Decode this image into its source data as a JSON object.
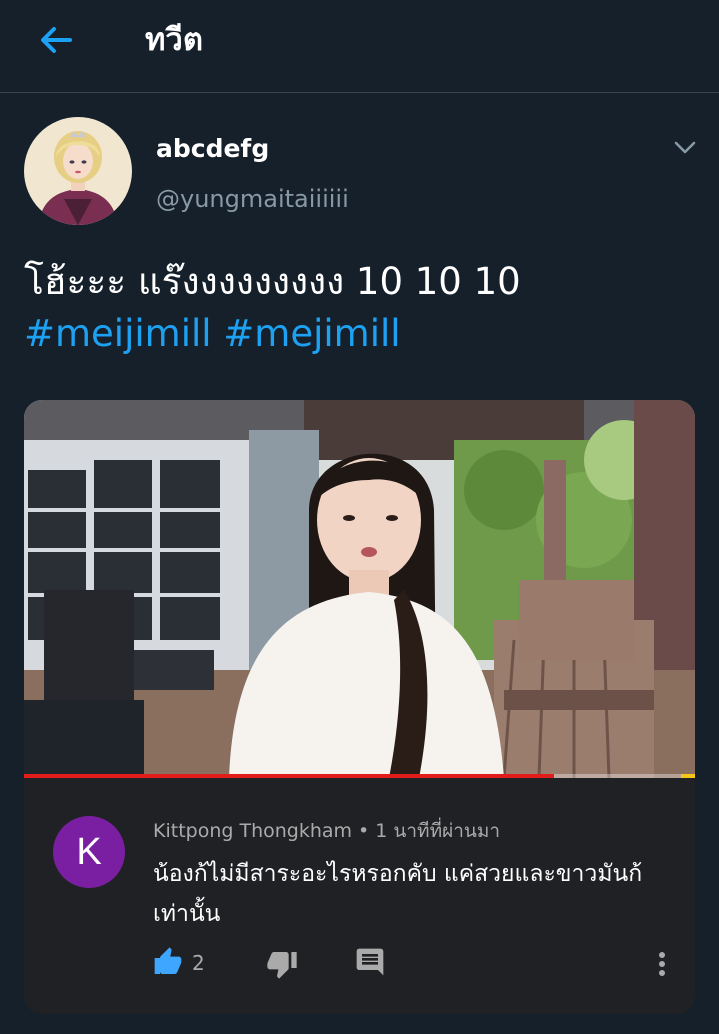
{
  "header": {
    "title": "ทวีต",
    "back_icon": "arrow-left-icon"
  },
  "tweet": {
    "author": {
      "display_name": "abcdefg",
      "handle": "@yungmaitaiiiiii"
    },
    "text": "โฮ้ะะะ แร๊งงงงงงงงง 10 10 10",
    "hashtags": [
      "#meijimill",
      "#mejimill"
    ],
    "more_icon": "chevron-down-icon"
  },
  "media": {
    "progress": 0.79,
    "comment": {
      "avatar_letter": "K",
      "author": "Kittpong Thongkham",
      "separator": "•",
      "time": "1 นาทีที่ผ่านมา",
      "text": "น้องก้ไม่มีสาระอะไรหรอกคับ  แค่สวยและขาวมันก้เท่านั้น",
      "like_count": "2",
      "icons": [
        "thumb-up-icon",
        "thumb-down-icon",
        "reply-icon",
        "more-vertical-icon"
      ]
    }
  },
  "colors": {
    "background": "#15202b",
    "accent": "#1da1f2",
    "secondary_text": "#8899a6",
    "comment_bg": "#202124",
    "comment_avatar": "#7b1fa2",
    "progress": "#e21b1b"
  }
}
